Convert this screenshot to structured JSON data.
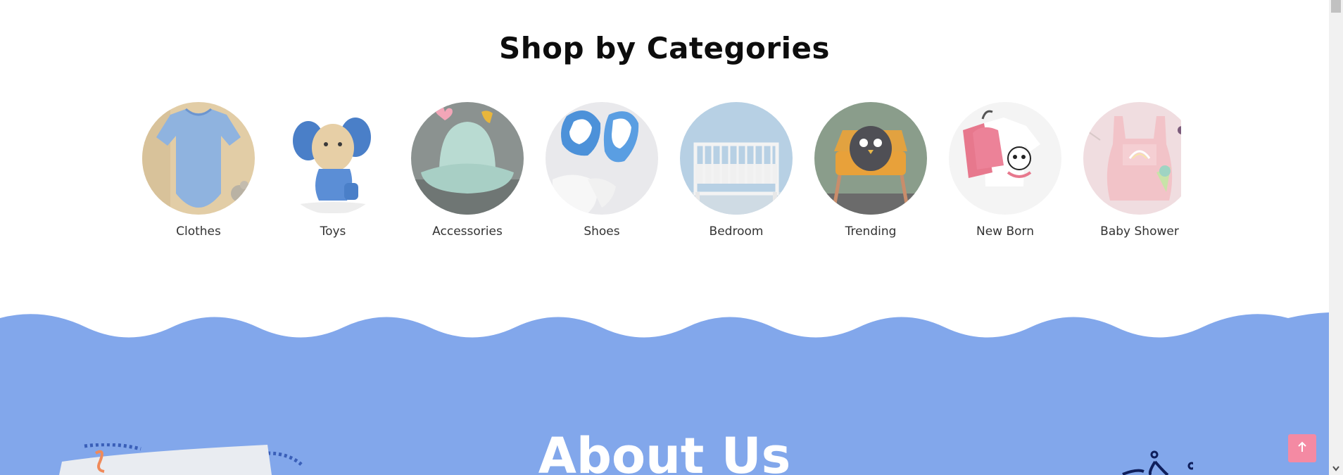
{
  "shop_section": {
    "title": "Shop by Categories",
    "categories": [
      {
        "label": "Clothes",
        "icon": "baby-bodysuit-image"
      },
      {
        "label": "Toys",
        "icon": "wooden-elephant-toy-image"
      },
      {
        "label": "Accessories",
        "icon": "bucket-hat-image"
      },
      {
        "label": "Shoes",
        "icon": "baby-sneakers-image"
      },
      {
        "label": "Bedroom",
        "icon": "crib-image"
      },
      {
        "label": "Trending",
        "icon": "armchair-plush-image"
      },
      {
        "label": "New Born",
        "icon": "newborn-clothes-image"
      },
      {
        "label": "Baby Shower",
        "icon": "pink-romper-image"
      }
    ]
  },
  "about_section": {
    "title": "About Us"
  },
  "colors": {
    "wave_blue": "#82a7eb",
    "scroll_top_pink": "#f48aa3"
  },
  "scroll_top": {
    "icon": "arrow-up-icon"
  }
}
